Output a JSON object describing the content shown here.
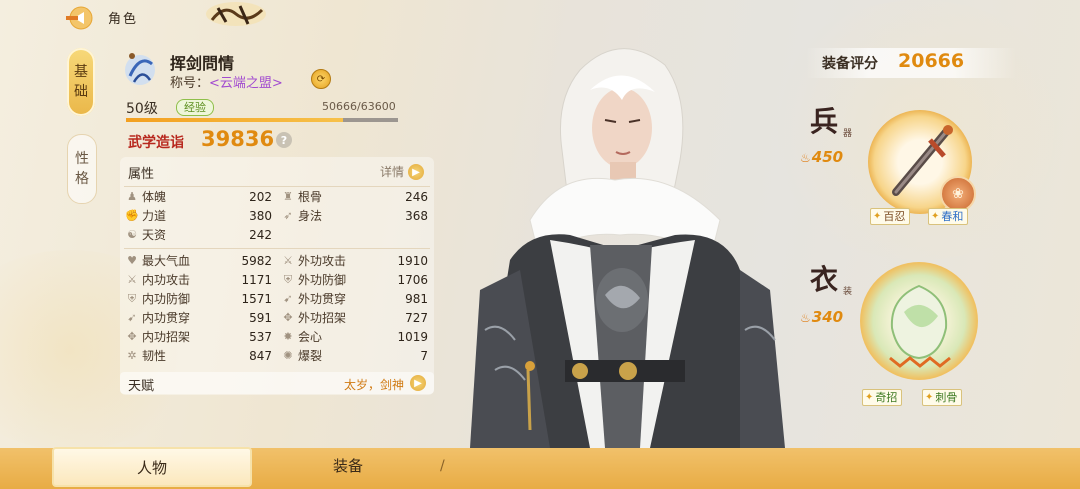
{
  "header": {
    "title": "角色"
  },
  "side_tabs": [
    {
      "label": "基础"
    },
    {
      "label": "性格"
    }
  ],
  "character": {
    "name": "挥剑問情",
    "title_label": "称号：",
    "title_value": "<云端之盟>",
    "level": "50级",
    "exp_badge": "经验",
    "exp_text": "50666/63600",
    "exp_fraction": 0.797,
    "martial_label": "武学造诣",
    "martial_value": "39836"
  },
  "attributes": {
    "heading": "属性",
    "detail": "详情",
    "basic": [
      {
        "name": "体魄",
        "value": "202",
        "icon": "body-icon"
      },
      {
        "name": "根骨",
        "value": "246",
        "icon": "bone-icon"
      },
      {
        "name": "力道",
        "value": "380",
        "icon": "strength-icon"
      },
      {
        "name": "身法",
        "value": "368",
        "icon": "agility-icon"
      },
      {
        "name": "天资",
        "value": "242",
        "icon": "talent-orb-icon"
      }
    ],
    "combat": [
      {
        "name": "最大气血",
        "value": "5982",
        "icon": "heart-icon"
      },
      {
        "name": "外功攻击",
        "value": "1910",
        "icon": "sword-icon"
      },
      {
        "name": "内功攻击",
        "value": "1171",
        "icon": "sword-icon"
      },
      {
        "name": "外功防御",
        "value": "1706",
        "icon": "shield-icon"
      },
      {
        "name": "内功防御",
        "value": "1571",
        "icon": "shield-icon"
      },
      {
        "name": "外功贯穿",
        "value": "981",
        "icon": "pierce-icon"
      },
      {
        "name": "内功贯穿",
        "value": "591",
        "icon": "pierce-icon"
      },
      {
        "name": "外功招架",
        "value": "727",
        "icon": "parry-icon"
      },
      {
        "name": "内功招架",
        "value": "537",
        "icon": "parry-icon"
      },
      {
        "name": "会心",
        "value": "1019",
        "icon": "crit-icon"
      },
      {
        "name": "韧性",
        "value": "847",
        "icon": "tenacity-icon"
      },
      {
        "name": "爆裂",
        "value": "7",
        "icon": "burst-icon"
      }
    ],
    "talent_label": "天赋",
    "talent_value": "太岁，剑神"
  },
  "equipment": {
    "score_label": "装备评分",
    "score_value": "20666",
    "weapon": {
      "category": "兵",
      "sub": "器",
      "power": "450",
      "tags": [
        "百忍",
        "春和"
      ]
    },
    "clothes": {
      "category": "衣",
      "sub": "装",
      "power": "340",
      "tags": [
        "奇招",
        "刺骨"
      ]
    }
  },
  "bottom_tabs": [
    {
      "label": "人物"
    },
    {
      "label": "装备"
    }
  ],
  "colors": {
    "accent_gold": "#e08a10",
    "martial_red": "#b8281e",
    "title_purple": "#a24bd0",
    "bottom_bar": "#e8ac45"
  }
}
